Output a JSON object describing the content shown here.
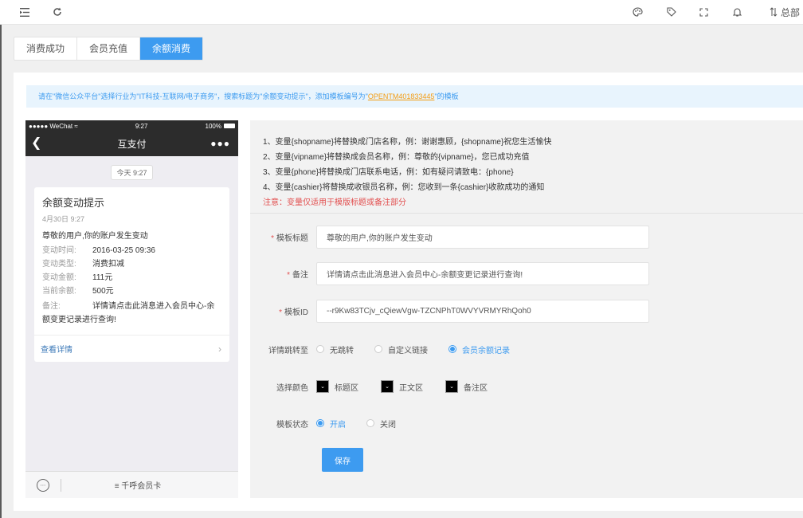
{
  "topbar": {
    "menu_icon": "menu-fold-icon",
    "refresh_icon": "refresh-icon",
    "theme_icon": "palette-icon",
    "tag_icon": "tag-icon",
    "fullscreen_icon": "fullscreen-icon",
    "bell_icon": "bell-icon",
    "user_label": "总部"
  },
  "tabs": [
    {
      "label": "消费成功",
      "active": false
    },
    {
      "label": "会员充值",
      "active": false
    },
    {
      "label": "余额消费",
      "active": true
    }
  ],
  "notice": {
    "prefix": "请在\"微信公众平台\"选择行业为\"IT科技-互联网/电子商务\"，搜索标题为\"余额变动提示\"，添加模板编号为\"",
    "code": "OPENTM401833445",
    "suffix": "\"的模板"
  },
  "phone": {
    "carrier": "●●●●● WeChat",
    "time": "9:27",
    "battery": "100%",
    "nav_title": "互支付",
    "chat_time": "今天 9:27",
    "card": {
      "title": "余额变动提示",
      "date": "4月30日 9:27",
      "greeting": "尊敬的用户,你的账户发生变动",
      "rows": [
        {
          "k": "变动时间:",
          "v": "2016-03-25 09:36"
        },
        {
          "k": "变动类型:",
          "v": "消费扣减"
        },
        {
          "k": "变动金额:",
          "v": "111元"
        },
        {
          "k": "当前余额:",
          "v": "500元"
        }
      ],
      "remark_key": "备注:",
      "remark_value": "详情请点击此消息进入会员中心-余额变更记录进行查询!",
      "footer": "查看详情"
    },
    "bottom_menu": "≡ 千呼会员卡"
  },
  "vars": {
    "lines": [
      "1、变量{shopname}将替换成门店名称，例：谢谢惠顾，{shopname}祝您生活愉快",
      "2、变量{vipname}将替换成会员名称，例：尊敬的{vipname}，您已成功充值",
      "3、变量{phone}将替换成门店联系电话，例：如有疑问请致电：{phone}",
      "4、变量{cashier}将替换成收银员名称，例：您收到一条{cashier}收款成功的通知"
    ],
    "note": "注意：变量仅适用于模版标题或备注部分"
  },
  "form": {
    "title_label": "模板标题",
    "title_value": "尊敬的用户,你的账户发生变动",
    "remark_label": "备注",
    "remark_value": "详情请点击此消息进入会员中心-余额变更记录进行查询!",
    "template_id_label": "模板ID",
    "template_id_value": "--r9Kw83TCjv_cQiewVgw-TZCNPhT0WVYVRMYRhQoh0",
    "jump_label": "详情跳转至",
    "jump_options": [
      {
        "label": "无跳转",
        "checked": false
      },
      {
        "label": "自定义链接",
        "checked": false
      },
      {
        "label": "会员余额记录",
        "checked": true
      }
    ],
    "color_label": "选择颜色",
    "color_options": [
      "标题区",
      "正文区",
      "备注区"
    ],
    "status_label": "模板状态",
    "status_options": [
      {
        "label": "开启",
        "checked": true
      },
      {
        "label": "关闭",
        "checked": false
      }
    ],
    "save_label": "保存"
  },
  "colors": {
    "accent": "#3d9bf0",
    "warning": "#e24f4f",
    "code_highlight": "#f39c12"
  }
}
